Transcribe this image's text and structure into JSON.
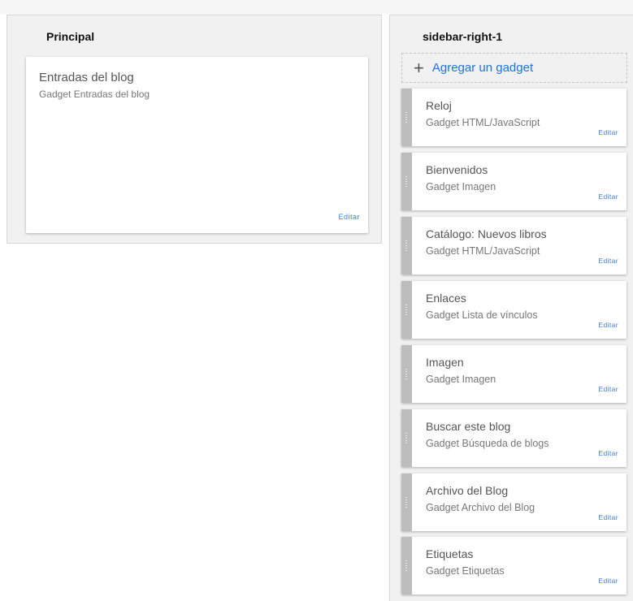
{
  "main_section": {
    "title": "Principal",
    "gadgets": [
      {
        "title": "Entradas del blog",
        "type": "Gadget Entradas del blog",
        "edit": "Editar"
      }
    ]
  },
  "sidebar_section": {
    "title": "sidebar-right-1",
    "add_icon": "+",
    "add_label": "Agregar un gadget",
    "gadgets": [
      {
        "title": "Reloj",
        "type": "Gadget HTML/JavaScript",
        "edit": "Editar"
      },
      {
        "title": "Bienvenidos",
        "type": "Gadget Imagen",
        "edit": "Editar"
      },
      {
        "title": "Catálogo: Nuevos libros",
        "type": "Gadget HTML/JavaScript",
        "edit": "Editar"
      },
      {
        "title": "Enlaces",
        "type": "Gadget Lista de vínculos",
        "edit": "Editar"
      },
      {
        "title": "Imagen",
        "type": "Gadget Imagen",
        "edit": "Editar"
      },
      {
        "title": "Buscar este blog",
        "type": "Gadget Búsqueda de blogs",
        "edit": "Editar"
      },
      {
        "title": "Archivo del Blog",
        "type": "Gadget Archivo del Blog",
        "edit": "Editar"
      },
      {
        "title": "Etiquetas",
        "type": "Gadget Etiquetas",
        "edit": "Editar"
      }
    ]
  }
}
